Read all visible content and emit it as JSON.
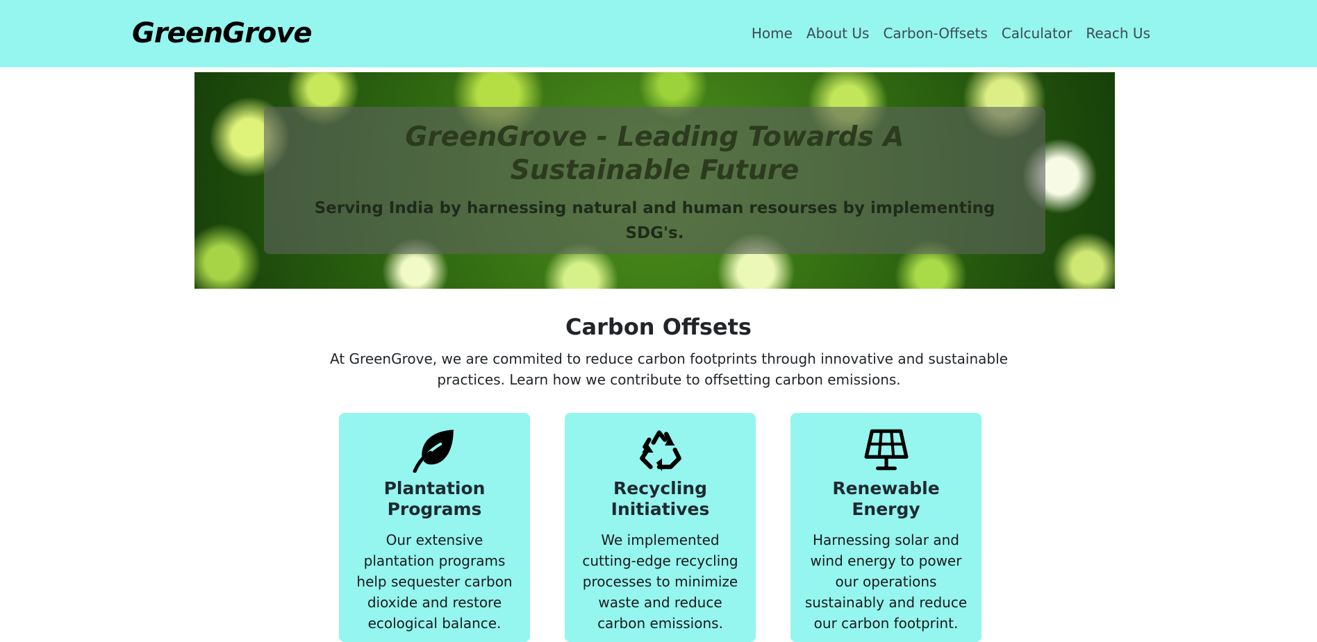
{
  "navbar": {
    "brand": "GreenGrove",
    "links": [
      "Home",
      "About Us",
      "Carbon-Offsets",
      "Calculator",
      "Reach Us"
    ]
  },
  "hero": {
    "title": "GreenGrove - Leading Towards A Sustainable Future",
    "subtitle": "Serving India by harnessing natural and human resourses by implementing SDG's."
  },
  "offsets": {
    "title": "Carbon Offsets",
    "intro": "At GreenGrove, we are commited to reduce carbon footprints through innovative and sustainable practices. Learn how we contribute to offsetting carbon emissions.",
    "cards": [
      {
        "icon": "leaf-icon",
        "title": "Plantation Programs",
        "text": "Our extensive plantation programs help sequester carbon dioxide and restore ecological balance."
      },
      {
        "icon": "recycle-icon",
        "title": "Recycling Initiatives",
        "text": "We implemented cutting-edge recycling processes to minimize waste and reduce carbon emissions."
      },
      {
        "icon": "solar-panel-icon",
        "title": "Renewable Energy",
        "text": "Harnessing solar and wind energy to power our operations sustainably and reduce our carbon footprint."
      }
    ]
  },
  "colors": {
    "navbar_bg": "#95f5ef",
    "card_bg": "#95f5ef",
    "text": "#212529"
  }
}
